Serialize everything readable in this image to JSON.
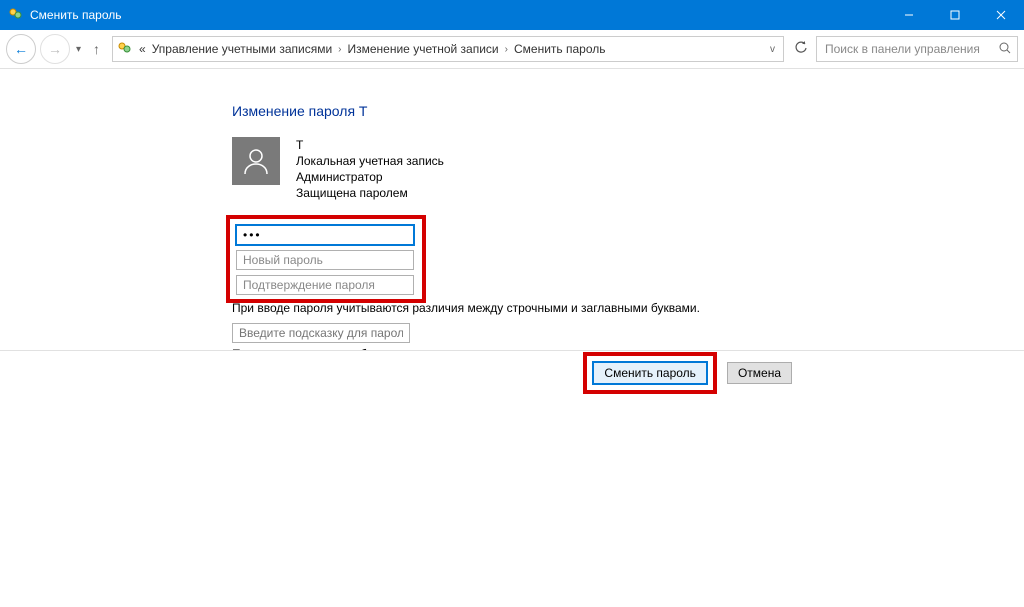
{
  "window": {
    "title": "Сменить пароль"
  },
  "breadcrumb": {
    "prefix": "«",
    "item1": "Управление учетными записями",
    "item2": "Изменение учетной записи",
    "item3": "Сменить пароль"
  },
  "search": {
    "placeholder": "Поиск в панели управления"
  },
  "page": {
    "heading": "Изменение пароля T"
  },
  "user": {
    "name": "T",
    "account_type": "Локальная учетная запись",
    "role": "Администратор",
    "protection": "Защищена паролем"
  },
  "inputs": {
    "current_password_value": "•••",
    "new_password_placeholder": "Новый пароль",
    "confirm_password_placeholder": "Подтверждение пароля",
    "case_sensitive_note": "При вводе пароля учитываются различия между строчными и заглавными буквами.",
    "hint_placeholder": "Введите подсказку для пароля",
    "hint_visible_note": "Подсказка для пароля будет видна всем, кто использует этот компьютер."
  },
  "buttons": {
    "change": "Сменить пароль",
    "cancel": "Отмена"
  }
}
